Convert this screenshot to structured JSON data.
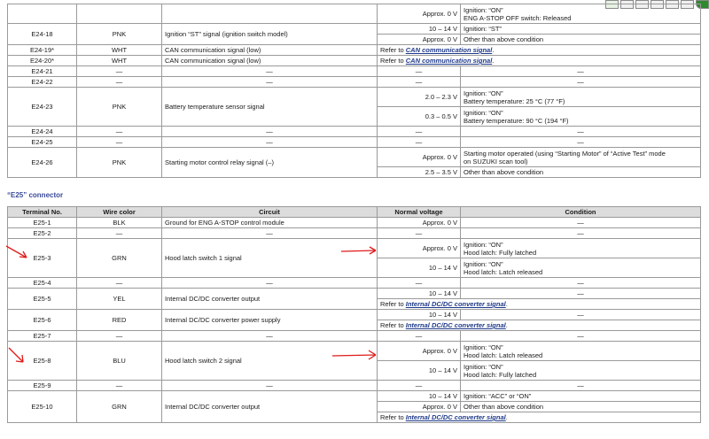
{
  "toolbar": {
    "icons": [
      "go-icon",
      "page-icon",
      "page-icon",
      "page-icon",
      "page-icon",
      "page-icon",
      "go-icon"
    ]
  },
  "table1": {
    "rows": [
      {
        "id": "top-a",
        "cells": [
          "",
          "",
          "",
          "Approx. 0 V",
          "Ignition: “ON”\nENG A-STOP OFF switch: Released"
        ]
      },
      {
        "id": "e24-18-a",
        "cells": [
          "E24-18",
          "PNK",
          "Ignition “ST” signal (ignition switch model)",
          "10 – 14 V",
          "Ignition: “ST”"
        ]
      },
      {
        "id": "e24-18-b",
        "cells": [
          "",
          "",
          "",
          "Approx. 0 V",
          "Other than above condition"
        ]
      },
      {
        "id": "e24-19",
        "ref": true,
        "cells": [
          "E24-19*",
          "WHT",
          "CAN communication signal (low)"
        ],
        "ref_text": "Refer to ",
        "ref_link": "CAN communication signal",
        "ref_end": "."
      },
      {
        "id": "e24-20",
        "ref": true,
        "cells": [
          "E24-20*",
          "WHT",
          "CAN communication signal (low)"
        ],
        "ref_text": "Refer to ",
        "ref_link": "CAN communication signal",
        "ref_end": "."
      },
      {
        "id": "e24-21",
        "cells": [
          "E24-21",
          "—",
          "—",
          "—",
          "—"
        ]
      },
      {
        "id": "e24-22",
        "cells": [
          "E24-22",
          "—",
          "—",
          "—",
          "—"
        ]
      },
      {
        "id": "e24-23-a",
        "cells": [
          "E24-23",
          "PNK",
          "Battery temperature sensor signal",
          "2.0 – 2.3 V",
          "Ignition: “ON”\nBattery temperature: 25 °C (77 °F)"
        ]
      },
      {
        "id": "e24-23-b",
        "cells": [
          "",
          "",
          "",
          "0.3 – 0.5 V",
          "Ignition: “ON”\nBattery temperature: 90 °C (194 °F)"
        ]
      },
      {
        "id": "e24-24",
        "cells": [
          "E24-24",
          "—",
          "—",
          "—",
          "—"
        ]
      },
      {
        "id": "e24-25",
        "cells": [
          "E24-25",
          "—",
          "—",
          "—",
          "—"
        ]
      },
      {
        "id": "e24-26-a",
        "cells": [
          "E24-26",
          "PNK",
          "Starting motor control relay signal (–)",
          "Approx. 0 V",
          "Starting motor operated (using “Starting Motor” of “Active Test” mode\non SUZUKI scan tool)"
        ]
      },
      {
        "id": "e24-26-b",
        "cells": [
          "",
          "",
          "",
          "2.5 – 3.5 V",
          "Other than above condition"
        ]
      }
    ]
  },
  "connector_title": "“E25” connector",
  "table2": {
    "headers": [
      "Terminal No.",
      "Wire color",
      "Circuit",
      "Normal voltage",
      "Condition"
    ],
    "rows": [
      {
        "id": "e25-1",
        "cells": [
          "E25-1",
          "BLK",
          "Ground for ENG A-STOP control module",
          "Approx. 0 V",
          "—"
        ]
      },
      {
        "id": "e25-2",
        "cells": [
          "E25-2",
          "—",
          "—",
          "—",
          "—"
        ]
      },
      {
        "id": "e25-3-a",
        "cells": [
          "E25-3",
          "GRN",
          "Hood latch switch 1 signal",
          "Approx. 0 V",
          "Ignition: “ON”\nHood latch: Fully latched"
        ]
      },
      {
        "id": "e25-3-b",
        "cells": [
          "",
          "",
          "",
          "10 – 14 V",
          "Ignition: “ON”\nHood latch: Latch released"
        ]
      },
      {
        "id": "e25-4",
        "cells": [
          "E25-4",
          "—",
          "—",
          "—",
          "—"
        ]
      },
      {
        "id": "e25-5-a",
        "cells": [
          "E25-5",
          "YEL",
          "Internal DC/DC converter output",
          "10 – 14 V",
          "—"
        ]
      },
      {
        "id": "e25-5-b",
        "ref": true,
        "cells": [],
        "ref_text": "Refer to ",
        "ref_link": "Internal DC/DC converter signal",
        "ref_end": "."
      },
      {
        "id": "e25-6-a",
        "cells": [
          "E25-6",
          "RED",
          "Internal DC/DC converter power supply",
          "10 – 14 V",
          "—"
        ]
      },
      {
        "id": "e25-6-b",
        "ref": true,
        "cells": [],
        "ref_text": "Refer to ",
        "ref_link": "Internal DC/DC converter signal",
        "ref_end": "."
      },
      {
        "id": "e25-7",
        "cells": [
          "E25-7",
          "—",
          "—",
          "—",
          "—"
        ]
      },
      {
        "id": "e25-8-a",
        "cells": [
          "E25-8",
          "BLU",
          "Hood latch switch 2 signal",
          "Approx. 0 V",
          "Ignition: “ON”\nHood latch: Latch released"
        ]
      },
      {
        "id": "e25-8-b",
        "cells": [
          "",
          "",
          "",
          "10 – 14 V",
          "Ignition: “ON”\nHood latch: Fully latched"
        ]
      },
      {
        "id": "e25-9",
        "cells": [
          "E25-9",
          "—",
          "—",
          "—",
          "—"
        ]
      },
      {
        "id": "e25-10-a",
        "cells": [
          "E25-10",
          "GRN",
          "Internal DC/DC converter output",
          "10 – 14 V",
          "Ignition: “ACC” or “ON”"
        ]
      },
      {
        "id": "e25-10-b",
        "cells": [
          "",
          "",
          "",
          "Approx. 0 V",
          "Other than above condition"
        ]
      },
      {
        "id": "e25-10-c",
        "ref": true,
        "cells": [],
        "ref_text": "Refer to ",
        "ref_link": "Internal DC/DC converter signal",
        "ref_end": "."
      }
    ]
  },
  "colors": {
    "arrow": "#e01a1a",
    "header_bg": "#dcdcdc",
    "link": "#1f3a8a",
    "title": "#3a4a9a"
  }
}
